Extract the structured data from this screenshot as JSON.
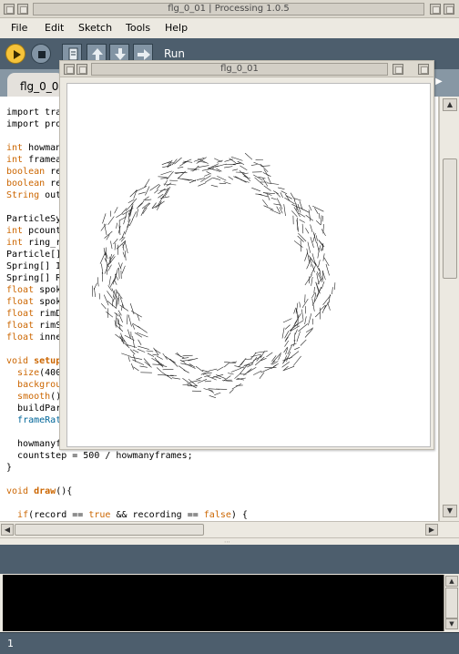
{
  "window": {
    "title": "flg_0_01 | Processing 1.0.5"
  },
  "menu": {
    "items": [
      "File",
      "Edit",
      "Sketch",
      "Tools",
      "Help"
    ]
  },
  "toolbar": {
    "status_label": "Run",
    "buttons": [
      "run-icon",
      "stop-icon",
      "new-icon",
      "open-icon",
      "save-icon",
      "export-icon"
    ]
  },
  "tabs": {
    "active": "flg_0_01",
    "arrow": "▶"
  },
  "sketch_window": {
    "title": "flg_0_01"
  },
  "code": {
    "lines": [
      [
        [
          "",
          "import tra"
        ]
      ],
      [
        [
          "",
          "import pro"
        ]
      ],
      [
        [
          "",
          ""
        ]
      ],
      [
        [
          "kw",
          "int"
        ],
        [
          "",
          " howman"
        ]
      ],
      [
        [
          "kw",
          "int"
        ],
        [
          "",
          " framea"
        ]
      ],
      [
        [
          "kw",
          "boolean"
        ],
        [
          "",
          " re"
        ]
      ],
      [
        [
          "kw",
          "boolean"
        ],
        [
          "",
          " re"
        ]
      ],
      [
        [
          "kw",
          "String"
        ],
        [
          "",
          " out"
        ]
      ],
      [
        [
          "",
          ""
        ]
      ],
      [
        [
          "",
          "ParticleSy"
        ]
      ],
      [
        [
          "kw",
          "int"
        ],
        [
          "",
          " pcount"
        ]
      ],
      [
        [
          "kw",
          "int"
        ],
        [
          "",
          " ring_r"
        ]
      ],
      [
        [
          "",
          "Particle[]"
        ]
      ],
      [
        [
          "",
          "Spring[] I"
        ]
      ],
      [
        [
          "",
          "Spring[] R"
        ]
      ],
      [
        [
          "kw",
          "float"
        ],
        [
          "",
          " spok"
        ]
      ],
      [
        [
          "kw",
          "float"
        ],
        [
          "",
          " spok"
        ]
      ],
      [
        [
          "kw",
          "float"
        ],
        [
          "",
          " rimD"
        ]
      ],
      [
        [
          "kw",
          "float"
        ],
        [
          "",
          " rimS"
        ]
      ],
      [
        [
          "kw",
          "float"
        ],
        [
          "",
          " inne"
        ]
      ],
      [
        [
          "",
          ""
        ]
      ],
      [
        [
          "kw",
          "void"
        ],
        [
          "",
          " "
        ],
        [
          "kb",
          "setup"
        ]
      ],
      [
        [
          "",
          "  "
        ],
        [
          "kw",
          "size"
        ],
        [
          "",
          "(400"
        ]
      ],
      [
        [
          "",
          "  "
        ],
        [
          "kw",
          "backgrou"
        ]
      ],
      [
        [
          "",
          "  "
        ],
        [
          "kw",
          "smooth"
        ],
        [
          "",
          "()"
        ]
      ],
      [
        [
          "",
          "  buildPar"
        ]
      ],
      [
        [
          "",
          "  "
        ],
        [
          "fn",
          "frameRat"
        ]
      ],
      [
        [
          "",
          ""
        ]
      ],
      [
        [
          "",
          "  howmanyf"
        ]
      ],
      [
        [
          "",
          "  countstep = 500 / howmanyframes;"
        ]
      ],
      [
        [
          "",
          "}"
        ]
      ],
      [
        [
          "",
          ""
        ]
      ],
      [
        [
          "kw",
          "void"
        ],
        [
          "",
          " "
        ],
        [
          "kb",
          "draw"
        ],
        [
          "",
          "(){"
        ]
      ],
      [
        [
          "",
          ""
        ]
      ],
      [
        [
          "",
          "  "
        ],
        [
          "kw",
          "if"
        ],
        [
          "",
          "(record == "
        ],
        [
          "kw",
          "true"
        ],
        [
          "",
          " && recording == "
        ],
        [
          "kw",
          "false"
        ],
        [
          "",
          ") {"
        ]
      ]
    ]
  },
  "status": {
    "line_number": "1"
  },
  "colors": {
    "toolbar": "#4d5e6d",
    "run_button": "#f6c33a",
    "keyword": "#cc6600",
    "function": "#006699"
  }
}
